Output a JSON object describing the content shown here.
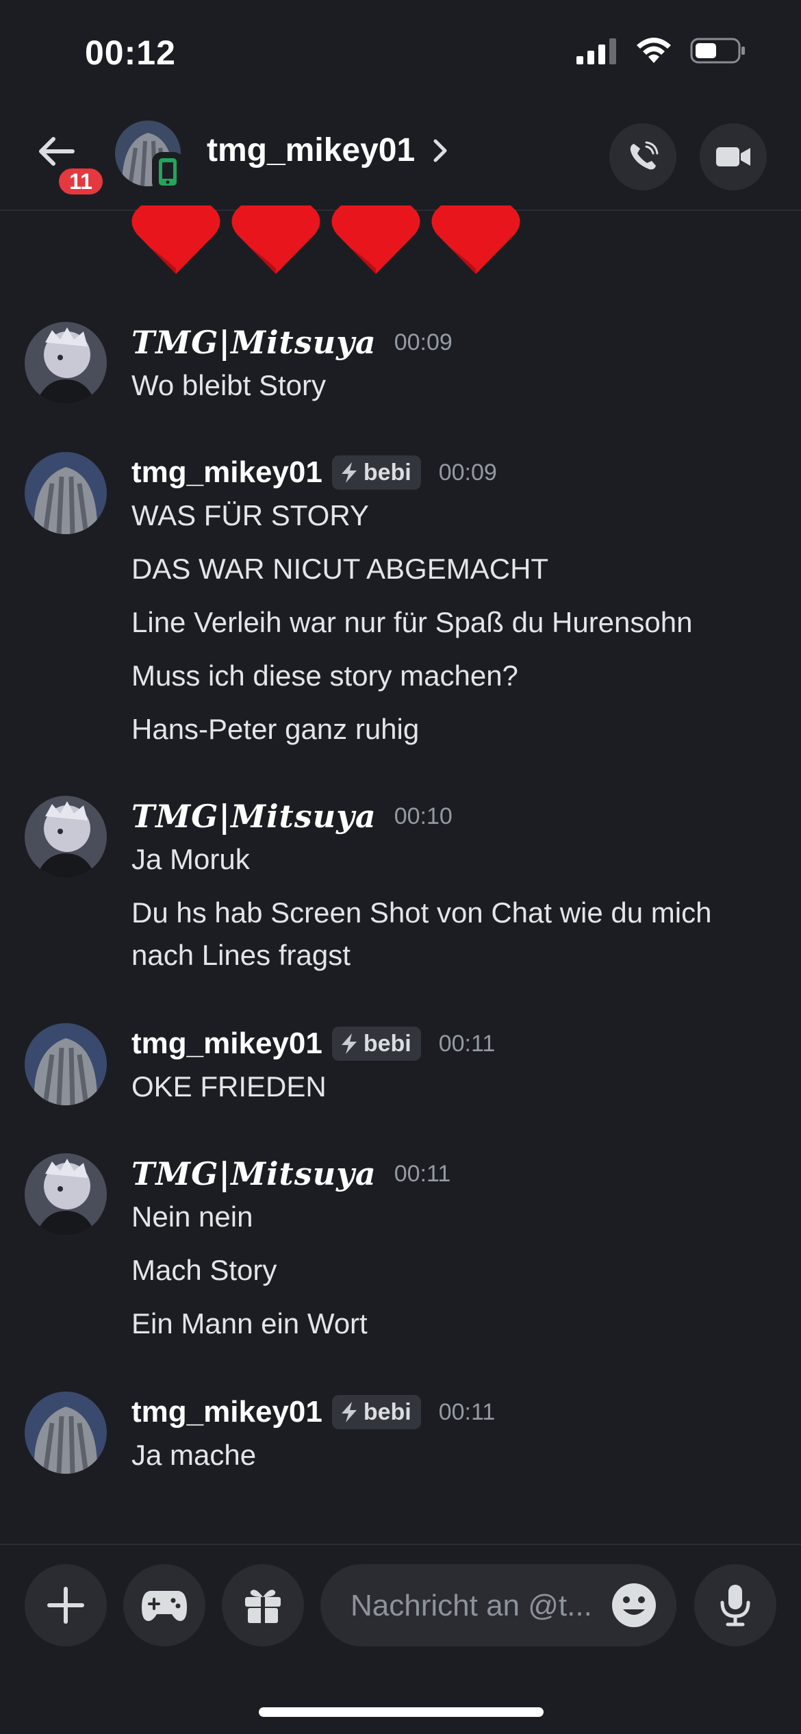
{
  "status_bar": {
    "time": "00:12"
  },
  "header": {
    "unread_count": "11",
    "channel_name": "tmg_mikey01"
  },
  "messages": [
    {
      "author": "𝑻𝑴𝑮|𝑴𝒊𝒕𝒔𝒖𝒚𝒂",
      "time": "00:09",
      "lines": [
        "Wo bleibt Story"
      ]
    },
    {
      "author": "tmg_mikey01",
      "tag": "bebi",
      "time": "00:09",
      "lines": [
        "WAS FÜR STORY",
        "DAS WAR NICUT ABGEMACHT",
        "Line Verleih war nur für Spaß du Hurensohn",
        "Muss ich diese story machen?",
        "Hans-Peter ganz ruhig"
      ]
    },
    {
      "author": "𝑻𝑴𝑮|𝑴𝒊𝒕𝒔𝒖𝒚𝒂",
      "time": "00:10",
      "lines": [
        "Ja Moruk",
        "Du hs hab Screen Shot von Chat wie du mich nach Lines fragst"
      ]
    },
    {
      "author": "tmg_mikey01",
      "tag": "bebi",
      "time": "00:11",
      "lines": [
        "OKE FRIEDEN"
      ]
    },
    {
      "author": "𝑻𝑴𝑮|𝑴𝒊𝒕𝒔𝒖𝒚𝒂",
      "time": "00:11",
      "lines": [
        "Nein nein",
        "Mach Story",
        "Ein Mann ein Wort"
      ]
    },
    {
      "author": "tmg_mikey01",
      "tag": "bebi",
      "time": "00:11",
      "lines": [
        "Ja mache"
      ]
    }
  ],
  "composer": {
    "placeholder": "Nachricht an @t..."
  },
  "colors": {
    "background": "#1c1d22",
    "badge": "#e5383f",
    "online_mobile": "#23a55a",
    "heart": "#e8161c"
  },
  "icons": [
    "back-arrow-icon",
    "mobile-phone-icon",
    "chevron-right-icon",
    "voice-call-icon",
    "video-call-icon",
    "heart-emoji",
    "lightning-icon",
    "plus-icon",
    "gamepad-icon",
    "gift-icon",
    "emoji-icon",
    "microphone-icon"
  ]
}
